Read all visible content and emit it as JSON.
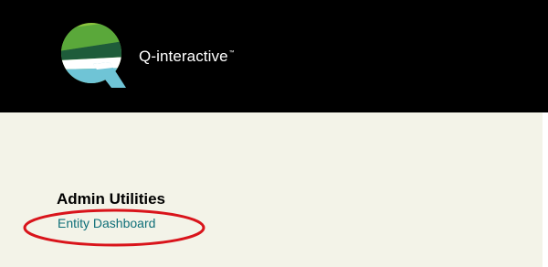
{
  "header": {
    "brand_name": "Q-interactive",
    "trademark": "™",
    "background": "#000000"
  },
  "content": {
    "background": "#f3f3e8",
    "section_title": "Admin Utilities",
    "link_label": "Entity Dashboard",
    "link_color": "#0f6f78"
  },
  "annotation": {
    "type": "red-ellipse-highlight",
    "color": "#d9141b"
  },
  "icons": {
    "logo": "q-interactive-logo-icon"
  }
}
